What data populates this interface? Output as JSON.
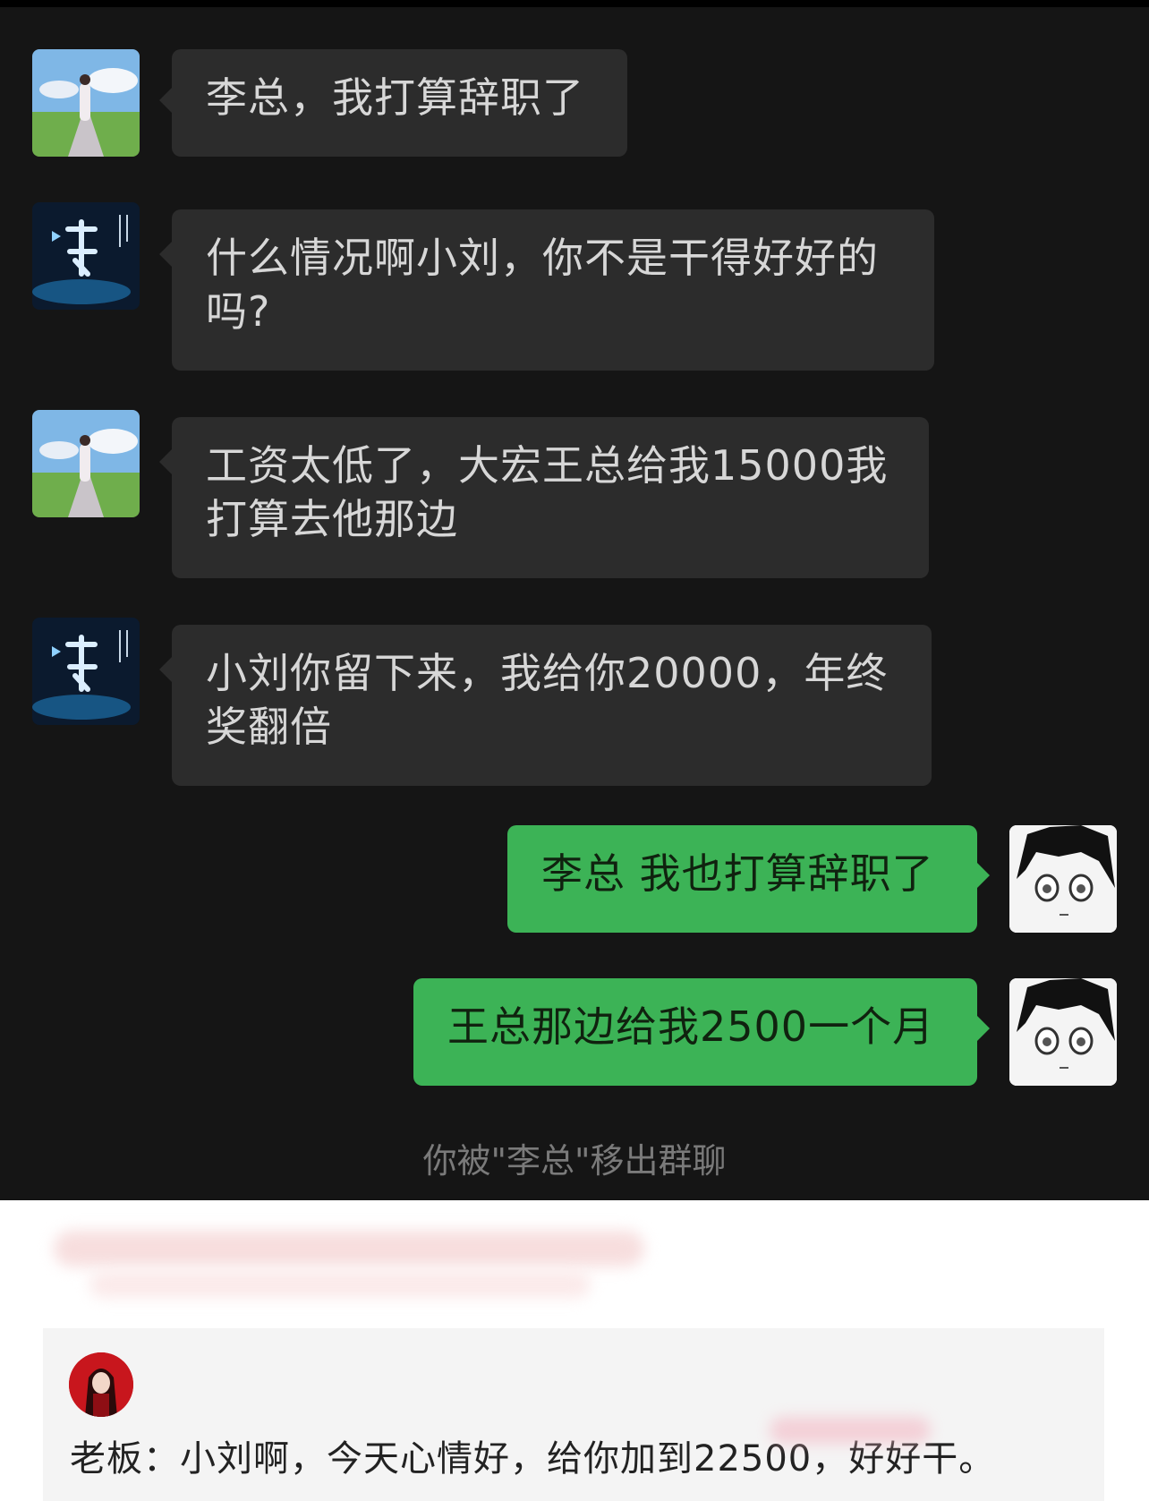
{
  "chat": {
    "messages": [
      {
        "side": "left",
        "avatar": "girl-on-road-avatar",
        "text": "李总，我打算辞职了"
      },
      {
        "side": "left",
        "avatar": "li-calligraphy-avatar",
        "text": "什么情况啊小刘，你不是干得好好的吗?"
      },
      {
        "side": "left",
        "avatar": "girl-on-road-avatar",
        "text": "工资太低了，大宏王总给我15000我打算去他那边"
      },
      {
        "side": "left",
        "avatar": "li-calligraphy-avatar",
        "text": "小刘你留下来，我给你20000，年终奖翻倍"
      },
      {
        "side": "right",
        "avatar": "manga-boy-avatar",
        "text": "李总 我也打算辞职了"
      },
      {
        "side": "right",
        "avatar": "manga-boy-avatar",
        "text": "王总那边给我2500一个月"
      }
    ],
    "system_notice": "你被\"李总\"移出群聊"
  },
  "comment": {
    "avatar": "red-anime-avatar",
    "text": "老板：小刘啊，今天心情好，给你加到22500，好好干。"
  },
  "colors": {
    "chat_bg": "#151515",
    "incoming_bubble": "#2c2c2c",
    "outgoing_bubble": "#3cb356"
  }
}
